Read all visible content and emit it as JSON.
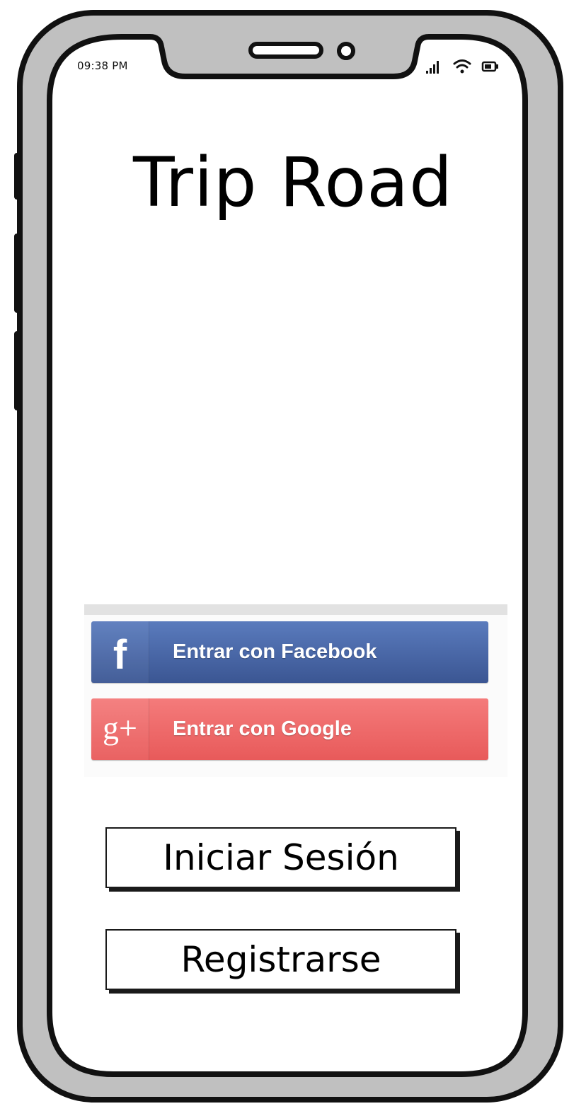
{
  "status_bar": {
    "time": "09:38 PM",
    "icons": [
      "signal-icon",
      "wifi-icon",
      "battery-icon"
    ]
  },
  "app": {
    "title": "Trip Road"
  },
  "social_login": {
    "facebook": {
      "icon": "facebook-icon",
      "icon_glyph": "f",
      "label": "Entrar con Facebook",
      "color": "#3b5998"
    },
    "google": {
      "icon": "google-plus-icon",
      "icon_glyph": "g+",
      "label": "Entrar con Google",
      "color": "#ef6666"
    }
  },
  "actions": {
    "login_label": "Iniciar Sesión",
    "register_label": "Registrarse"
  }
}
